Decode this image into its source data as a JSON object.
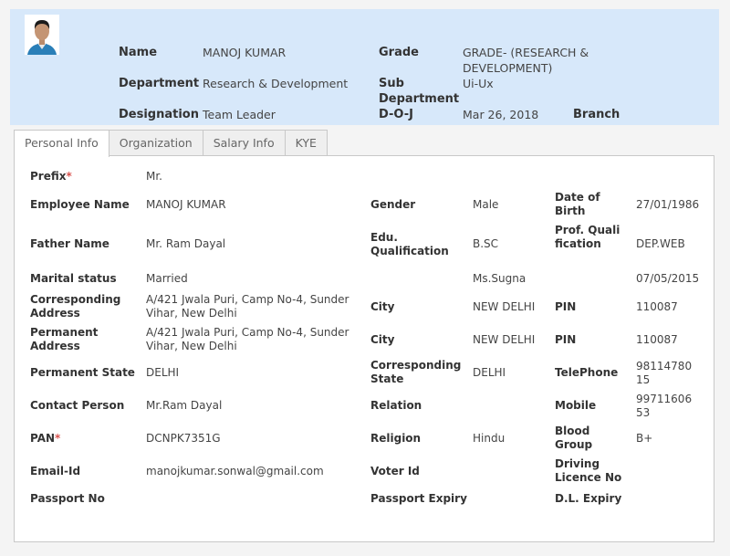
{
  "employee": {
    "name_label": "Name",
    "name": "MANOJ KUMAR",
    "grade_label": "Grade",
    "grade": "GRADE- (RESEARCH & DEVELOPMENT)",
    "department_label": "Department",
    "department": "Research & Development",
    "sub_department_label": "Sub Department",
    "sub_department": "Ui-Ux",
    "designation_label": "Designation",
    "designation": "Team Leader",
    "doj_label": "D-O-J",
    "doj": "Mar 26, 2018",
    "branch_label": "Branch"
  },
  "tabs": [
    {
      "label": "Personal Info",
      "active": true
    },
    {
      "label": "Organization",
      "active": false
    },
    {
      "label": "Salary Info",
      "active": false
    },
    {
      "label": "KYE",
      "active": false
    }
  ],
  "personal": {
    "prefix_label": "Prefix",
    "prefix": "Mr.",
    "employee_name_label": "Employee Name",
    "employee_name": "MANOJ KUMAR",
    "gender_label": "Gender",
    "gender": "Male",
    "dob_label": "Date of Birth",
    "dob": "27/01/1986",
    "father_name_label": "Father Name",
    "father_name": "Mr. Ram Dayal",
    "edu_label": "Edu. Qualification",
    "edu": "B.SC",
    "prof_label": "Prof. Qualification",
    "prof": "DEP.WEB",
    "marital_label": "Marital status",
    "marital": "Married",
    "spouse_name": "Ms.Sugna",
    "anniversary": "07/05/2015",
    "corr_address_label": "Corresponding Address",
    "corr_address": "A/421 Jwala Puri, Camp No-4, Sunder Vihar, New Delhi",
    "city_label": "City",
    "corr_city": "NEW DELHI",
    "pin_label": "PIN",
    "corr_pin": "110087",
    "perm_address_label": "Permanent Address",
    "perm_address": "A/421 Jwala Puri, Camp No-4, Sunder Vihar, New Delhi",
    "perm_city": "NEW DELHI",
    "perm_pin": "110087",
    "perm_state_label": "Permanent State",
    "perm_state": "DELHI",
    "corr_state_label": "Corresponding State",
    "corr_state": "DELHI",
    "telephone_label": "TelePhone",
    "telephone": "9811478015",
    "contact_label": "Contact Person",
    "contact": "Mr.Ram Dayal",
    "relation_label": "Relation",
    "mobile_label": "Mobile",
    "mobile": "9971160653",
    "pan_label": "PAN",
    "pan": "DCNPK7351G",
    "religion_label": "Religion",
    "religion": "Hindu",
    "blood_label": "Blood Group",
    "blood": "B+",
    "email_label": "Email-Id",
    "email": "manojkumar.sonwal@gmail.com",
    "voter_label": "Voter Id",
    "dl_label": "Driving Licence No",
    "passport_label": "Passport No",
    "passport_expiry_label": "Passport Expiry",
    "dl_expiry_label": "D.L. Expiry"
  }
}
